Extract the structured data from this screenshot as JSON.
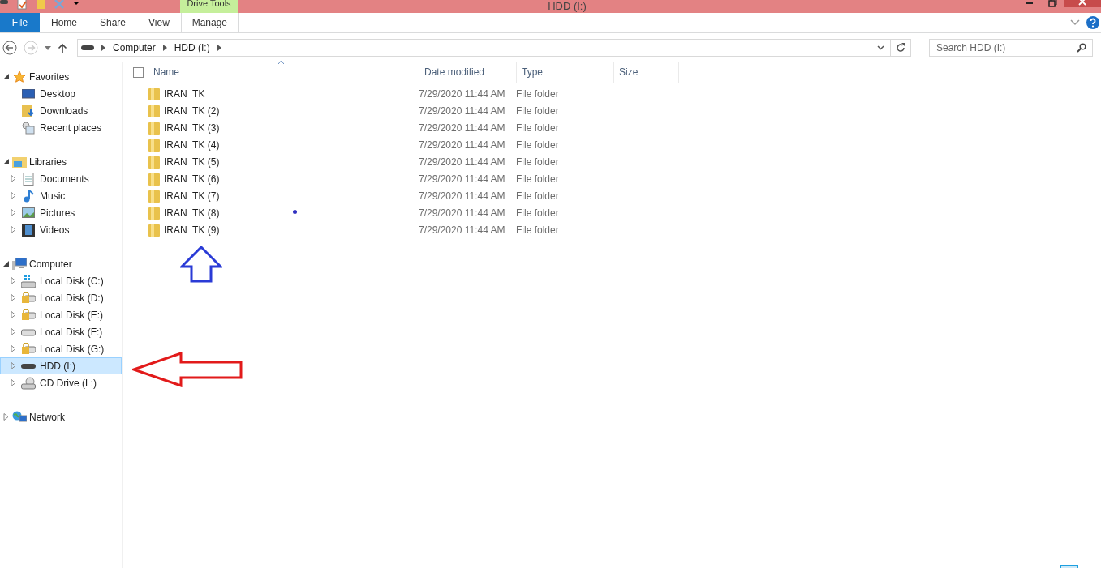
{
  "window": {
    "title": "HDD (I:)"
  },
  "ribbon": {
    "context_group": "Drive Tools",
    "tabs": [
      {
        "label": "File",
        "kind": "file",
        "selected": false
      },
      {
        "label": "Home",
        "kind": "tab",
        "selected": false
      },
      {
        "label": "Share",
        "kind": "tab",
        "selected": false
      },
      {
        "label": "View",
        "kind": "tab",
        "selected": false
      },
      {
        "label": "Manage",
        "kind": "context",
        "selected": false
      }
    ]
  },
  "address": {
    "crumbs": [
      "Computer",
      "HDD (I:)"
    ]
  },
  "search": {
    "placeholder": "Search HDD (I:)"
  },
  "sidebar": {
    "groups": [
      {
        "label": "Favorites",
        "kind": "star",
        "expanded": true,
        "children": [
          {
            "label": "Desktop",
            "kind": "desktop",
            "expandable": false,
            "selected": false
          },
          {
            "label": "Downloads",
            "kind": "downloads",
            "expandable": false,
            "selected": false
          },
          {
            "label": "Recent places",
            "kind": "recent",
            "expandable": false,
            "selected": false
          }
        ]
      },
      {
        "label": "Libraries",
        "kind": "library",
        "expanded": true,
        "children": [
          {
            "label": "Documents",
            "kind": "document",
            "expandable": true,
            "selected": false
          },
          {
            "label": "Music",
            "kind": "music",
            "expandable": true,
            "selected": false
          },
          {
            "label": "Pictures",
            "kind": "pictures",
            "expandable": true,
            "selected": false
          },
          {
            "label": "Videos",
            "kind": "videos",
            "expandable": true,
            "selected": false
          }
        ]
      },
      {
        "label": "Computer",
        "kind": "computer",
        "expanded": true,
        "children": [
          {
            "label": "Local Disk (C:)",
            "kind": "system-disk",
            "expandable": true,
            "selected": false
          },
          {
            "label": "Local Disk (D:)",
            "kind": "locked-disk",
            "expandable": true,
            "selected": false
          },
          {
            "label": "Local Disk (E:)",
            "kind": "locked-disk",
            "expandable": true,
            "selected": false
          },
          {
            "label": "Local Disk (F:)",
            "kind": "disk",
            "expandable": true,
            "selected": false
          },
          {
            "label": "Local Disk (G:)",
            "kind": "locked-disk",
            "expandable": true,
            "selected": false
          },
          {
            "label": "HDD (I:)",
            "kind": "hdd",
            "expandable": true,
            "selected": true
          },
          {
            "label": "CD Drive (L:)",
            "kind": "cd",
            "expandable": true,
            "selected": false
          }
        ]
      },
      {
        "label": "Network",
        "kind": "network",
        "expanded": false
      }
    ]
  },
  "table": {
    "select_all_checked": false,
    "columns": [
      "Name",
      "Date modified",
      "Type",
      "Size"
    ],
    "rows": [
      {
        "name": "IRAN  TK",
        "date": "7/29/2020 11:44 AM",
        "type": "File folder"
      },
      {
        "name": "IRAN  TK (2)",
        "date": "7/29/2020 11:44 AM",
        "type": "File folder"
      },
      {
        "name": "IRAN  TK (3)",
        "date": "7/29/2020 11:44 AM",
        "type": "File folder"
      },
      {
        "name": "IRAN  TK (4)",
        "date": "7/29/2020 11:44 AM",
        "type": "File folder"
      },
      {
        "name": "IRAN  TK (5)",
        "date": "7/29/2020 11:44 AM",
        "type": "File folder"
      },
      {
        "name": "IRAN  TK (6)",
        "date": "7/29/2020 11:44 AM",
        "type": "File folder"
      },
      {
        "name": "IRAN  TK (7)",
        "date": "7/29/2020 11:44 AM",
        "type": "File folder"
      },
      {
        "name": "IRAN  TK (8)",
        "date": "7/29/2020 11:44 AM",
        "type": "File folder"
      },
      {
        "name": "IRAN  TK (9)",
        "date": "7/29/2020 11:44 AM",
        "type": "File folder"
      }
    ]
  }
}
